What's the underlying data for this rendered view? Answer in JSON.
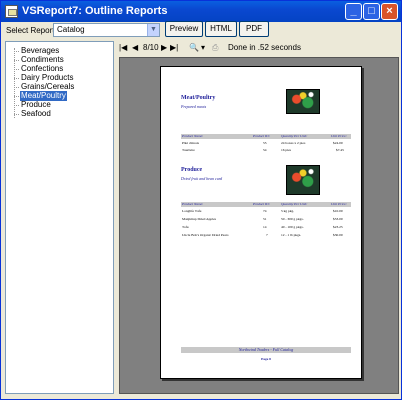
{
  "window": {
    "title": "VSReport7: Outline Reports"
  },
  "toolbar": {
    "select_label": "Select Report:",
    "report_value": "Catalog",
    "preview_label": "Preview",
    "html_label": "HTML",
    "pdf_label": "PDF"
  },
  "tree": {
    "items": [
      "Beverages",
      "Condiments",
      "Confections",
      "Dairy Products",
      "Grains/Cereals",
      "Meat/Poultry",
      "Produce",
      "Seafood"
    ],
    "selected": "Meat/Poultry"
  },
  "preview_toolbar": {
    "page_indicator": "8/10",
    "status": "Done in .52 seconds"
  },
  "report_page": {
    "sections": [
      {
        "title": "Meat/Poultry",
        "description": "Prepared meats",
        "columns": [
          "Product Name:",
          "Product ID:",
          "Quantity Per Unit:",
          "Unit Price:"
        ],
        "rows": [
          [
            "Pâté chinois",
            "55",
            "24 boxes x 2 pies",
            "$24.00"
          ],
          [
            "Tourtière",
            "54",
            "16 pies",
            "$7.45"
          ]
        ]
      },
      {
        "title": "Produce",
        "description": "Dried fruit and bean curd",
        "columns": [
          "Product Name:",
          "Product ID:",
          "Quantity Per Unit:",
          "Unit Price:"
        ],
        "rows": [
          [
            "Longlife Tofu",
            "74",
            "5 kg pkg.",
            "$10.00"
          ],
          [
            "Manjimup Dried Apples",
            "51",
            "50 - 300 g pkgs.",
            "$53.00"
          ],
          [
            "Tofu",
            "14",
            "40 - 100 g pkgs.",
            "$23.25"
          ],
          [
            "Uncle Bob's Organic Dried Pears",
            "7",
            "12 - 1 lb pkgs.",
            "$30.00"
          ]
        ]
      }
    ],
    "footer_text": "Northwind Traders - Full Catalog",
    "page_text": "Page 8"
  }
}
